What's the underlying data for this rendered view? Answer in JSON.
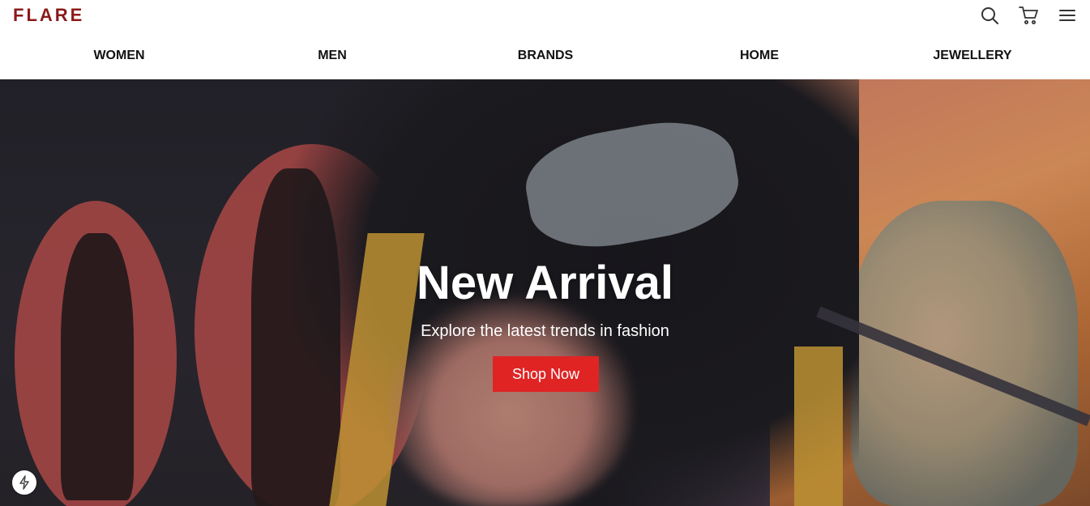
{
  "brand": {
    "logo": "FLARE",
    "color": "#8b1a1a"
  },
  "header_icons": [
    {
      "name": "search-icon"
    },
    {
      "name": "cart-icon"
    },
    {
      "name": "menu-icon"
    }
  ],
  "nav": {
    "items": [
      {
        "label": "WOMEN"
      },
      {
        "label": "MEN"
      },
      {
        "label": "BRANDS"
      },
      {
        "label": "HOME"
      },
      {
        "label": "JEWELLERY"
      }
    ]
  },
  "hero": {
    "title": "New Arrival",
    "subtitle": "Explore the latest trends in fashion",
    "cta_label": "Shop Now",
    "cta_color": "#e02424"
  },
  "floating": {
    "icon": "lightning-icon"
  }
}
